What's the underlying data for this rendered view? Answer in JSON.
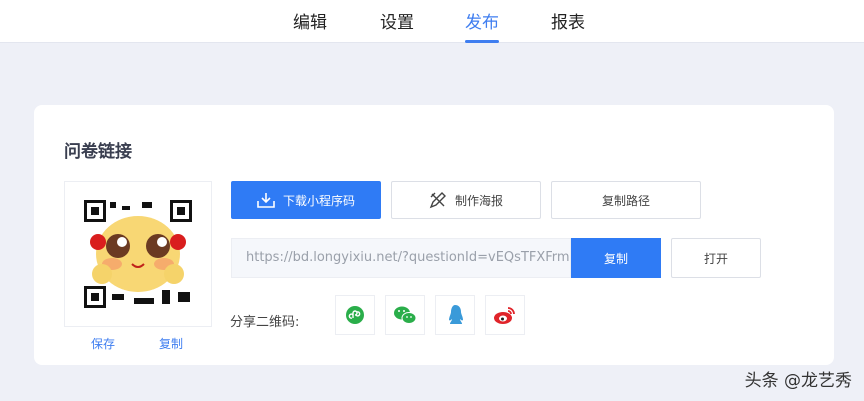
{
  "tabs": [
    {
      "label": "编辑"
    },
    {
      "label": "设置"
    },
    {
      "label": "发布",
      "active": true
    },
    {
      "label": "报表"
    }
  ],
  "card": {
    "title": "问卷链接",
    "qr": {
      "save": "保存",
      "copy": "复制"
    },
    "buttons": {
      "download": "下载小程序码",
      "poster": "制作海报",
      "copy_path": "复制路径"
    },
    "url": {
      "value": "https://bd.longyixiu.net/?questionId=vEQsTFXFrm",
      "copy": "复制",
      "open": "打开"
    },
    "share": {
      "label": "分享二维码:",
      "icons": [
        "mini-program-icon",
        "wechat-icon",
        "qq-icon",
        "weibo-icon"
      ]
    }
  },
  "watermark": "头条 @龙艺秀",
  "colors": {
    "accent": "#2f7bf5"
  }
}
